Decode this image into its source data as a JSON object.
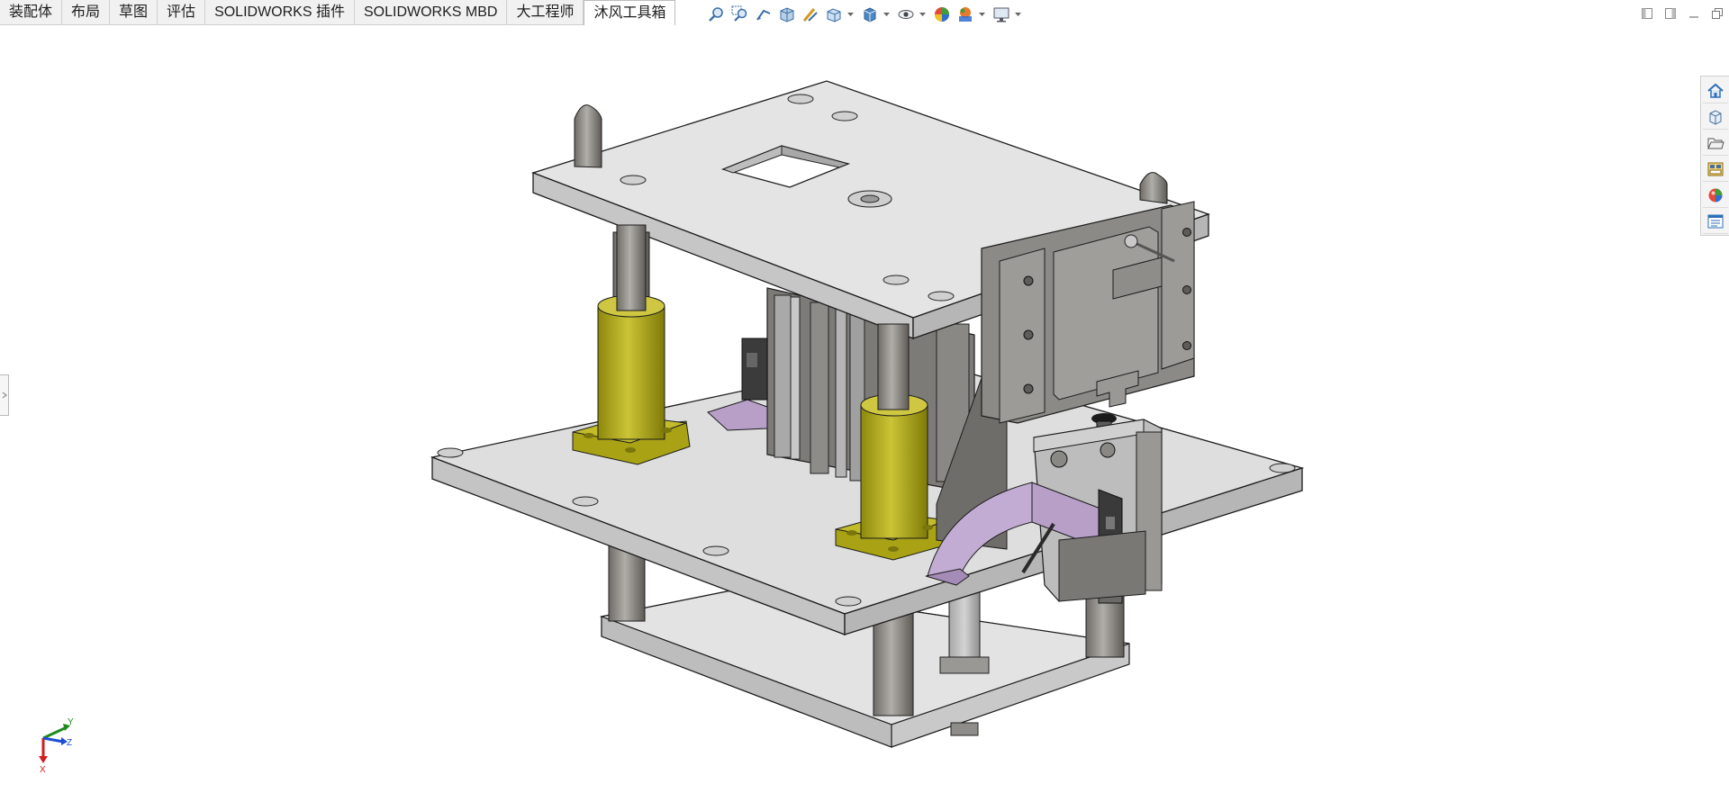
{
  "tabs": [
    {
      "label": "装配体"
    },
    {
      "label": "布局"
    },
    {
      "label": "草图"
    },
    {
      "label": "评估"
    },
    {
      "label": "SOLIDWORKS 插件"
    },
    {
      "label": "SOLIDWORKS MBD"
    },
    {
      "label": "大工程师"
    },
    {
      "label": "沐风工具箱",
      "active": true
    }
  ],
  "heads_up_toolbar": {
    "icons": [
      "zoom-to-fit-icon",
      "zoom-to-area-icon",
      "previous-view-icon",
      "section-view-icon",
      "dynamic-annotation-view-icon",
      "view-orientation-icon",
      "display-style-icon",
      "hide-show-items-icon",
      "edit-appearance-icon",
      "apply-scene-icon",
      "view-settings-icon"
    ]
  },
  "window_controls": [
    "tile-left-icon",
    "tile-right-icon",
    "minimize-icon",
    "restore-icon"
  ],
  "task_pane": [
    "home-icon",
    "design-library-icon",
    "file-explorer-icon",
    "view-palette-icon",
    "appearances-icon",
    "custom-properties-icon"
  ],
  "triad": {
    "x_label": "X",
    "y_label": "Y",
    "z_label": "Z"
  },
  "colors": {
    "plate_top": "#e2e2e2",
    "plate_side": "#c4c4c4",
    "column": "#8f8d89",
    "bushing": "#a8a214",
    "bracket": "#b79fc8",
    "cylinder": "#7d7a76"
  }
}
